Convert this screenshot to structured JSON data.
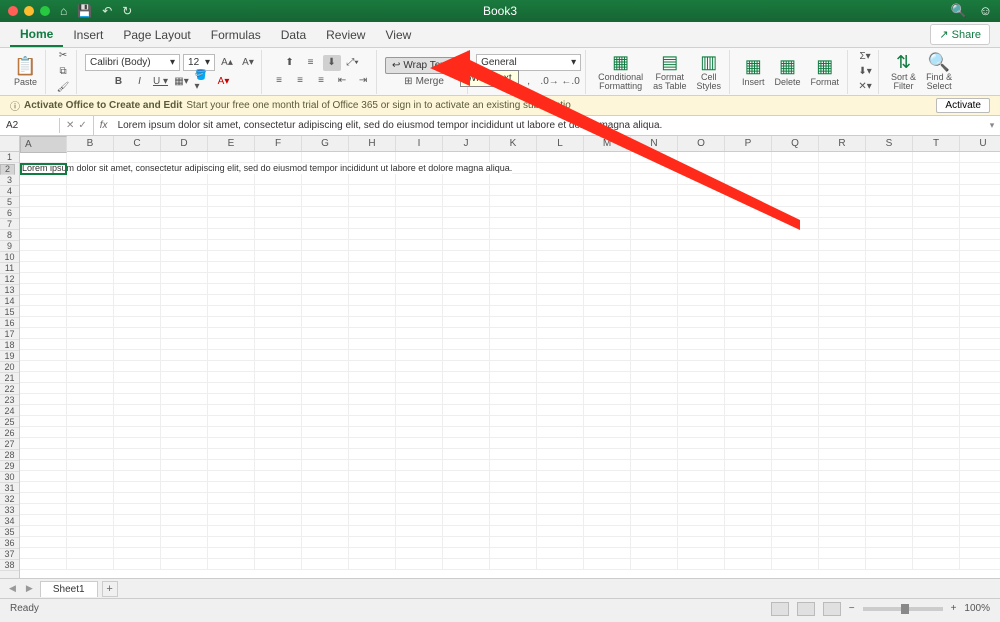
{
  "titlebar": {
    "title": "Book3"
  },
  "tabs": {
    "items": [
      "Home",
      "Insert",
      "Page Layout",
      "Formulas",
      "Data",
      "Review",
      "View"
    ],
    "active": 0,
    "share": "Share"
  },
  "ribbon": {
    "paste": "Paste",
    "font_name": "Calibri (Body)",
    "font_size": "12",
    "wrap_text": "Wrap Text",
    "wrap_tooltip": "Wrap Text",
    "merge": "Merge",
    "number_format": "General",
    "cond_fmt": "Conditional\nFormatting",
    "fmt_table": "Format\nas Table",
    "cell_styles": "Cell\nStyles",
    "insert": "Insert",
    "delete": "Delete",
    "format": "Format",
    "sort": "Sort &\nFilter",
    "find": "Find &\nSelect"
  },
  "activate": {
    "bold": "Activate Office to Create and Edit",
    "msg": "Start your free one month trial of Office 365 or sign in to activate an existing subscriptio",
    "btn": "Activate"
  },
  "formula": {
    "cell_ref": "A2",
    "value": "Lorem ipsum dolor sit amet, consectetur adipiscing elit, sed do eiusmod tempor incididunt ut labore et dolore magna aliqua."
  },
  "grid": {
    "columns": [
      "A",
      "B",
      "C",
      "D",
      "E",
      "F",
      "G",
      "H",
      "I",
      "J",
      "K",
      "L",
      "M",
      "N",
      "O",
      "P",
      "Q",
      "R",
      "S",
      "T",
      "U"
    ],
    "row_count": 38,
    "active_cell": "A2",
    "cell_text": "Lorem ipsum dolor sit amet, consectetur adipiscing elit, sed do eiusmod tempor incididunt ut labore et dolore magna aliqua."
  },
  "sheet": {
    "name": "Sheet1"
  },
  "status": {
    "ready": "Ready",
    "zoom": "100%"
  }
}
